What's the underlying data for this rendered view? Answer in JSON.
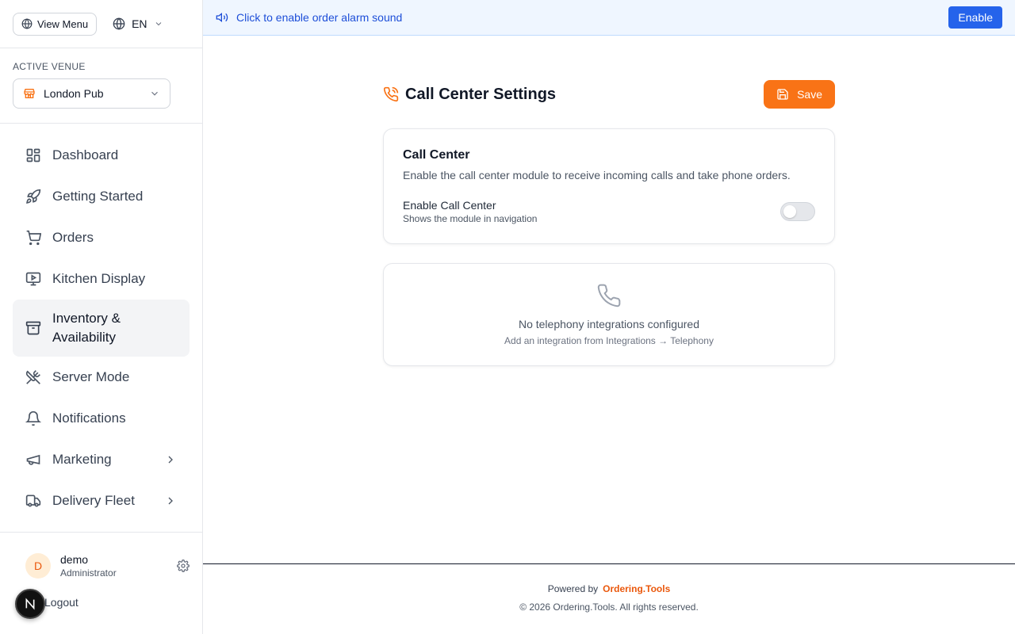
{
  "sidebar": {
    "view_menu_label": "View Menu",
    "language": "EN",
    "venue_label": "ACTIVE VENUE",
    "venue_name": "London Pub",
    "nav": [
      {
        "label": "Dashboard",
        "icon": "dashboard-icon"
      },
      {
        "label": "Getting Started",
        "icon": "rocket-icon"
      },
      {
        "label": "Orders",
        "icon": "cart-icon"
      },
      {
        "label": "Kitchen Display",
        "icon": "monitor-icon"
      },
      {
        "label": "Inventory & Availability",
        "icon": "archive-icon",
        "active": true
      },
      {
        "label": "Server Mode",
        "icon": "utensils-crossed-icon"
      },
      {
        "label": "Notifications",
        "icon": "bell-icon"
      },
      {
        "label": "Marketing",
        "icon": "megaphone-icon",
        "has_children": true
      },
      {
        "label": "Delivery Fleet",
        "icon": "truck-icon",
        "has_children": true
      }
    ],
    "user": {
      "initial": "D",
      "name": "demo",
      "role": "Administrator"
    },
    "logout_label": "Logout"
  },
  "banner": {
    "text": "Click to enable order alarm sound",
    "button_label": "Enable"
  },
  "page": {
    "title": "Call Center Settings",
    "save_label": "Save"
  },
  "call_center_card": {
    "title": "Call Center",
    "description": "Enable the call center module to receive incoming calls and take phone orders.",
    "toggle_label": "Enable Call Center",
    "toggle_sub": "Shows the module in navigation",
    "toggle_on": false
  },
  "telephony_card": {
    "title": "No telephony integrations configured",
    "subtitle": "Add an integration from Integrations → Telephony"
  },
  "footer": {
    "powered_by": "Powered by",
    "brand": "Ordering.Tools",
    "copyright": "© 2026 Ordering.Tools. All rights reserved."
  },
  "colors": {
    "accent": "#f97316",
    "banner_blue": "#2563eb",
    "banner_bg": "#eff6ff"
  }
}
